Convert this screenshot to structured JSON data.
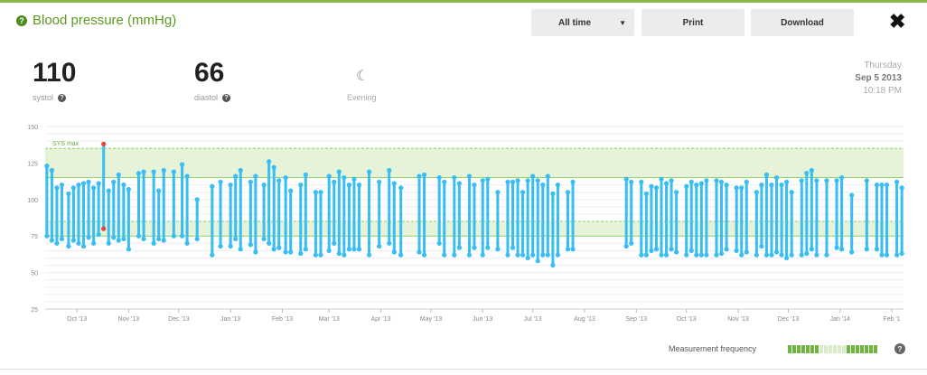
{
  "header": {
    "title": "Blood pressure (mmHg)",
    "range_label": "All time",
    "print_label": "Print",
    "download_label": "Download"
  },
  "readout": {
    "systolic_value": "110",
    "systolic_label": "systol",
    "diastolic_value": "66",
    "diastolic_label": "diastol",
    "period_label": "Evening",
    "day": "Thursday",
    "date": "Sep 5 2013",
    "time": "10:18 PM"
  },
  "footer": {
    "frequency_label": "Measurement frequency",
    "frequency_levels": [
      1,
      1,
      1,
      1,
      1,
      1,
      1,
      0.4,
      0.4,
      0.4,
      0.2,
      0.2,
      0.2,
      1,
      1,
      1,
      1,
      1,
      1,
      1
    ]
  },
  "colors": {
    "accent": "#5a9a1e",
    "series": "#38bdf4",
    "alert": "#e8443a",
    "band": "#e6f3d9",
    "band_line": "#8fd26a",
    "freq_on": "#6fb43f",
    "freq_off": "#d9ecc9"
  },
  "chart_data": {
    "type": "range",
    "ylim": [
      25,
      150
    ],
    "yticks": [
      25,
      50,
      75,
      100,
      125,
      150
    ],
    "xlim": [
      "2013-09-01",
      "2014-02-01"
    ],
    "x_ticks": [
      {
        "date": "2013-10-01",
        "label": "Oct '13"
      },
      {
        "date": "2013-11-01",
        "label": "Nov '13"
      },
      {
        "date": "2013-12-01",
        "label": "Dec '13"
      },
      {
        "date": "2014-01-01",
        "label": "Jan '13"
      },
      {
        "date": "2014-02-01",
        "label": "Feb '13"
      },
      {
        "date": "2014-03-01",
        "label": "Mar '13"
      },
      {
        "date": "2014-04-01",
        "label": "Apr '13"
      },
      {
        "date": "2014-05-01",
        "label": "May '13"
      },
      {
        "date": "2014-06-01",
        "label": "Jun '13"
      },
      {
        "date": "2014-07-01",
        "label": "Jul '13"
      },
      {
        "date": "2014-08-01",
        "label": "Aug '13"
      },
      {
        "date": "2014-09-01",
        "label": "Sep '13"
      },
      {
        "date": "2014-10-01",
        "label": "Oct '13"
      },
      {
        "date": "2014-11-01",
        "label": "Nov '13"
      },
      {
        "date": "2014-12-01",
        "label": "Dec '13"
      },
      {
        "date": "2015-01-01",
        "label": "Jan '14"
      },
      {
        "date": "2015-02-01",
        "label": "Feb '1"
      }
    ],
    "x_range": [
      "2013-09-12",
      "2015-02-08"
    ],
    "bands": [
      {
        "label": "SYS max",
        "from": 115,
        "to": 135
      },
      {
        "label": "",
        "from": 75,
        "to": 85
      }
    ],
    "series": [
      {
        "role": "normal",
        "points": [
          [
            "2013-09-13",
            75,
            123
          ],
          [
            "2013-09-16",
            72,
            120
          ],
          [
            "2013-09-19",
            70,
            108
          ],
          [
            "2013-09-22",
            73,
            110
          ],
          [
            "2013-09-26",
            68,
            104
          ],
          [
            "2013-09-29",
            72,
            108
          ],
          [
            "2013-10-02",
            70,
            110
          ],
          [
            "2013-10-05",
            68,
            111
          ],
          [
            "2013-10-08",
            74,
            112
          ],
          [
            "2013-10-11",
            70,
            108
          ],
          [
            "2013-10-14",
            76,
            111
          ],
          [
            "2013-10-20",
            70,
            106
          ],
          [
            "2013-10-23",
            74,
            112
          ],
          [
            "2013-10-26",
            72,
            117
          ],
          [
            "2013-10-29",
            73,
            110
          ],
          [
            "2013-11-01",
            66,
            107
          ],
          [
            "2013-11-07",
            75,
            118
          ],
          [
            "2013-11-10",
            73,
            119
          ],
          [
            "2013-11-16",
            70,
            119
          ],
          [
            "2013-11-19",
            73,
            106
          ],
          [
            "2013-11-22",
            72,
            120
          ],
          [
            "2013-11-28",
            75,
            119
          ],
          [
            "2013-12-03",
            75,
            124
          ],
          [
            "2013-12-06",
            70,
            116
          ],
          [
            "2013-12-12",
            73,
            100
          ],
          [
            "2013-12-21",
            62,
            109
          ],
          [
            "2013-12-26",
            68,
            112
          ],
          [
            "2014-01-01",
            68,
            110
          ],
          [
            "2014-01-04",
            73,
            116
          ],
          [
            "2014-01-07",
            66,
            120
          ],
          [
            "2014-01-13",
            69,
            112
          ],
          [
            "2014-01-16",
            64,
            116
          ],
          [
            "2014-01-21",
            73,
            110
          ],
          [
            "2014-01-24",
            70,
            126
          ],
          [
            "2014-01-27",
            66,
            122
          ],
          [
            "2014-01-30",
            67,
            113
          ],
          [
            "2014-02-03",
            64,
            115
          ],
          [
            "2014-02-06",
            64,
            106
          ],
          [
            "2014-02-12",
            63,
            110
          ],
          [
            "2014-02-15",
            66,
            117
          ],
          [
            "2014-02-21",
            62,
            105
          ],
          [
            "2014-02-24",
            62,
            105
          ],
          [
            "2014-03-01",
            65,
            116
          ],
          [
            "2014-03-04",
            70,
            112
          ],
          [
            "2014-03-07",
            63,
            119
          ],
          [
            "2014-03-10",
            62,
            115
          ],
          [
            "2014-03-13",
            66,
            110
          ],
          [
            "2014-03-16",
            66,
            114
          ],
          [
            "2014-03-19",
            66,
            110
          ],
          [
            "2014-03-25",
            62,
            119
          ],
          [
            "2014-03-31",
            68,
            112
          ],
          [
            "2014-04-06",
            70,
            120
          ],
          [
            "2014-04-09",
            64,
            111
          ],
          [
            "2014-04-13",
            62,
            108
          ],
          [
            "2014-04-24",
            64,
            116
          ],
          [
            "2014-04-27",
            62,
            117
          ],
          [
            "2014-05-06",
            70,
            115
          ],
          [
            "2014-05-09",
            62,
            112
          ],
          [
            "2014-05-15",
            62,
            115
          ],
          [
            "2014-05-18",
            67,
            111
          ],
          [
            "2014-05-24",
            62,
            116
          ],
          [
            "2014-05-27",
            67,
            110
          ],
          [
            "2014-06-01",
            62,
            113
          ],
          [
            "2014-06-04",
            67,
            114
          ],
          [
            "2014-06-10",
            66,
            105
          ],
          [
            "2014-06-16",
            62,
            112
          ],
          [
            "2014-06-19",
            67,
            112
          ],
          [
            "2014-06-22",
            62,
            113
          ],
          [
            "2014-06-25",
            62,
            105
          ],
          [
            "2014-06-28",
            60,
            113
          ],
          [
            "2014-07-01",
            62,
            116
          ],
          [
            "2014-07-04",
            58,
            113
          ],
          [
            "2014-07-07",
            62,
            110
          ],
          [
            "2014-07-10",
            62,
            116
          ],
          [
            "2014-07-13",
            55,
            104
          ],
          [
            "2014-07-16",
            62,
            110
          ],
          [
            "2014-07-22",
            66,
            105
          ],
          [
            "2014-07-25",
            66,
            112
          ],
          [
            "2014-08-26",
            68,
            114
          ],
          [
            "2014-08-29",
            70,
            112
          ],
          [
            "2014-09-04",
            62,
            112
          ],
          [
            "2014-09-07",
            62,
            104
          ],
          [
            "2014-09-10",
            65,
            109
          ],
          [
            "2014-09-13",
            66,
            108
          ],
          [
            "2014-09-16",
            62,
            114
          ],
          [
            "2014-09-19",
            62,
            111
          ],
          [
            "2014-09-22",
            66,
            113
          ],
          [
            "2014-09-25",
            64,
            105
          ],
          [
            "2014-10-01",
            62,
            109
          ],
          [
            "2014-10-04",
            65,
            112
          ],
          [
            "2014-10-07",
            62,
            110
          ],
          [
            "2014-10-10",
            62,
            111
          ],
          [
            "2014-10-13",
            62,
            113
          ],
          [
            "2014-10-19",
            62,
            113
          ],
          [
            "2014-10-22",
            63,
            112
          ],
          [
            "2014-10-25",
            66,
            110
          ],
          [
            "2014-10-31",
            65,
            108
          ],
          [
            "2014-11-03",
            62,
            108
          ],
          [
            "2014-11-06",
            64,
            112
          ],
          [
            "2014-11-12",
            62,
            105
          ],
          [
            "2014-11-15",
            68,
            110
          ],
          [
            "2014-11-18",
            62,
            117
          ],
          [
            "2014-11-21",
            62,
            110
          ],
          [
            "2014-11-24",
            64,
            115
          ],
          [
            "2014-11-27",
            62,
            110
          ],
          [
            "2014-11-30",
            60,
            112
          ],
          [
            "2014-12-03",
            62,
            105
          ],
          [
            "2014-12-09",
            62,
            113
          ],
          [
            "2014-12-12",
            63,
            118
          ],
          [
            "2014-12-15",
            66,
            120
          ],
          [
            "2014-12-18",
            62,
            113
          ],
          [
            "2014-12-24",
            62,
            113
          ],
          [
            "2014-12-30",
            67,
            113
          ],
          [
            "2015-01-02",
            66,
            115
          ],
          [
            "2015-01-08",
            64,
            103
          ],
          [
            "2015-01-17",
            66,
            113
          ],
          [
            "2015-01-23",
            66,
            110
          ],
          [
            "2015-01-26",
            62,
            110
          ],
          [
            "2015-01-29",
            62,
            110
          ],
          [
            "2015-02-04",
            62,
            112
          ],
          [
            "2015-02-07",
            63,
            108
          ]
        ]
      },
      {
        "role": "alert",
        "points": [
          [
            "2013-10-17",
            80,
            138
          ]
        ]
      }
    ]
  }
}
